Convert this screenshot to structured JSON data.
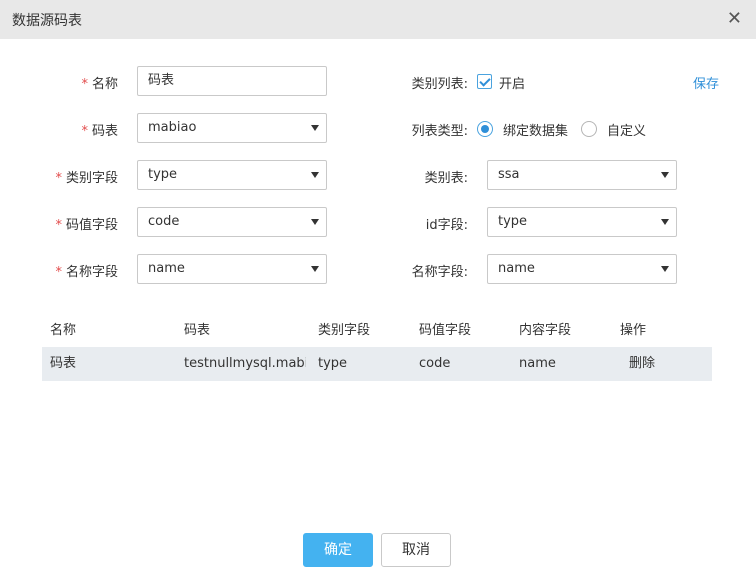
{
  "dialog": {
    "title": "数据源码表",
    "close_glyph": "✕"
  },
  "form": {
    "required_mark": "*",
    "name_label": "名称",
    "name_value": "码表",
    "codetable_label": "码表",
    "codetable_value": "mabiao",
    "category_field_label": "类别字段",
    "category_field_value": "type",
    "code_field_label": "码值字段",
    "code_field_value": "code",
    "name_field_label": "名称字段",
    "name_field_value": "name",
    "category_list_label": "类别列表:",
    "enable_label": "开启",
    "enable_checked": true,
    "save_link": "保存",
    "list_type_label": "列表类型:",
    "list_type_options": [
      "绑定数据集",
      "自定义"
    ],
    "list_type_selected": "绑定数据集",
    "category_table_label": "类别表:",
    "category_table_value": "ssa",
    "id_field_label": "id字段:",
    "id_field_value": "type",
    "name_field2_label": "名称字段:",
    "name_field2_value": "name"
  },
  "table": {
    "headers": [
      "名称",
      "码表",
      "类别字段",
      "码值字段",
      "内容字段",
      "操作"
    ],
    "rows": [
      {
        "name": "码表",
        "codetable": "testnullmysql.mabi...",
        "category": "type",
        "code": "code",
        "content": "name",
        "action": "删除"
      }
    ]
  },
  "footer": {
    "confirm": "确定",
    "cancel": "取消"
  },
  "colors": {
    "accent": "#2f8fd8",
    "primary_button": "#44b2f0",
    "required": "#e24b4b",
    "title_bar": "#e8e8e8",
    "row_bg": "#e8ecf0"
  }
}
